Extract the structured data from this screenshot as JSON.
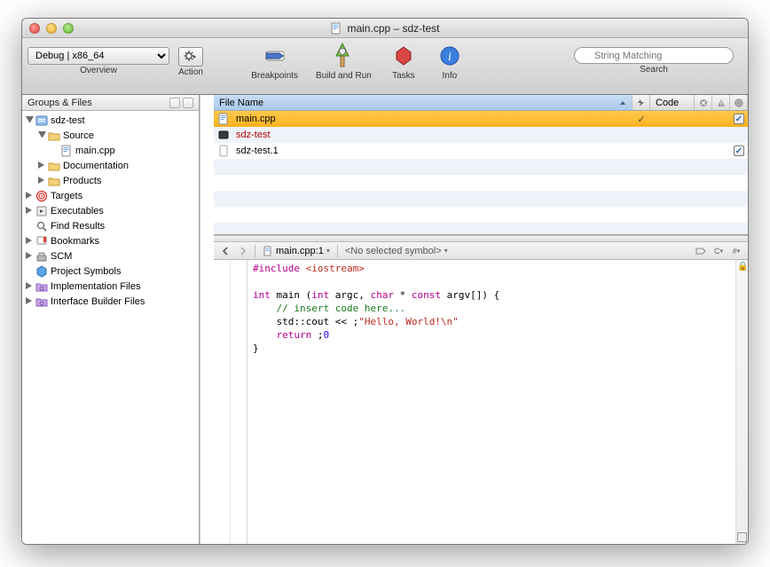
{
  "window": {
    "title": "main.cpp – sdz-test"
  },
  "toolbar": {
    "config": "Debug | x86_64",
    "overview_label": "Overview",
    "action_label": "Action",
    "breakpoints_label": "Breakpoints",
    "build_run_label": "Build and Run",
    "tasks_label": "Tasks",
    "info_label": "Info",
    "search_label": "Search",
    "search_placeholder": "String Matching"
  },
  "sidebar": {
    "header": "Groups & Files",
    "items": [
      {
        "label": "sdz-test",
        "depth": 0,
        "open": true,
        "icon": "project"
      },
      {
        "label": "Source",
        "depth": 1,
        "open": true,
        "icon": "folder"
      },
      {
        "label": "main.cpp",
        "depth": 2,
        "open": null,
        "icon": "cpp"
      },
      {
        "label": "Documentation",
        "depth": 1,
        "open": false,
        "icon": "folder"
      },
      {
        "label": "Products",
        "depth": 1,
        "open": false,
        "icon": "folder"
      },
      {
        "label": "Targets",
        "depth": 0,
        "open": false,
        "icon": "target"
      },
      {
        "label": "Executables",
        "depth": 0,
        "open": false,
        "icon": "exec"
      },
      {
        "label": "Find Results",
        "depth": 0,
        "open": null,
        "icon": "find"
      },
      {
        "label": "Bookmarks",
        "depth": 0,
        "open": false,
        "icon": "bookmark"
      },
      {
        "label": "SCM",
        "depth": 0,
        "open": false,
        "icon": "scm"
      },
      {
        "label": "Project Symbols",
        "depth": 0,
        "open": null,
        "icon": "symbols"
      },
      {
        "label": "Implementation Files",
        "depth": 0,
        "open": false,
        "icon": "smart"
      },
      {
        "label": "Interface Builder Files",
        "depth": 0,
        "open": false,
        "icon": "smart"
      }
    ]
  },
  "filelist": {
    "columns": {
      "filename": "File Name",
      "code": "Code"
    },
    "rows": [
      {
        "name": "main.cpp",
        "selected": true,
        "kind": "cpp",
        "compiled": true,
        "member": true
      },
      {
        "name": "sdz-test",
        "selected": false,
        "kind": "target",
        "compiled": false,
        "member": false
      },
      {
        "name": "sdz-test.1",
        "selected": false,
        "kind": "file",
        "compiled": false,
        "member": true
      }
    ]
  },
  "editor": {
    "crumb_file": "main.cpp:1",
    "crumb_symbol": "<No selected symbol>",
    "code_lines": [
      {
        "t": "#include ",
        "k": "kw",
        "tail": "<iostream>",
        "tail_k": "inc"
      },
      {
        "t": "",
        "k": ""
      },
      {
        "t": "int",
        "k": "kw",
        "tail": " main (",
        "t2": "int",
        "k2": "kw",
        "tail2": " argc, ",
        "t3": "char",
        "k3": "kw",
        "tail3": " * ",
        "t4": "const",
        "k4": "kw",
        "tail4": " argv[]) {"
      },
      {
        "indent": 1,
        "t": "// insert code here...",
        "k": "com"
      },
      {
        "indent": 1,
        "t": "std::cout << ",
        "str": "\"Hello, World!\\n\"",
        "tail": ";"
      },
      {
        "indent": 1,
        "t": "return",
        "k": "kw",
        "tail": " ",
        "num": "0",
        "tail2": ";"
      },
      {
        "t": "}"
      }
    ]
  }
}
